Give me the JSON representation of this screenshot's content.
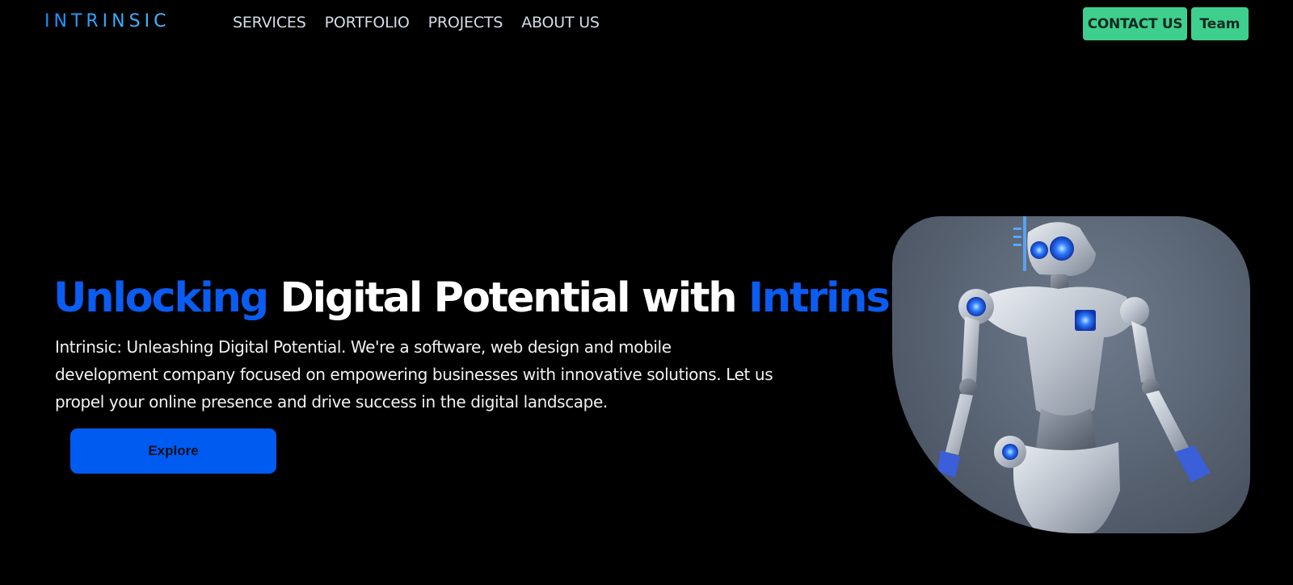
{
  "brand": {
    "logo_text": "INTRINSIC"
  },
  "nav": {
    "items": [
      {
        "label": "SERVICES"
      },
      {
        "label": "PORTFOLIO"
      },
      {
        "label": "PROJECTS"
      },
      {
        "label": "ABOUT US"
      }
    ]
  },
  "header_actions": {
    "contact_label": "CONTACT US",
    "team_label": "Team"
  },
  "hero": {
    "title_part1": "Unlocking",
    "title_part2": " Digital Potential with ",
    "title_part3": "Intrinsic",
    "description": "Intrinsic: Unleashing Digital Potential. We're a software, web design and mobile development company focused on empowering businesses with innovative solutions. Let us propel your online presence and drive success in the digital landscape.",
    "cta_label": "Explore",
    "image_subject": "robot-illustration"
  },
  "colors": {
    "background": "#000000",
    "accent_blue": "#0b5cf0",
    "button_blue": "#005bf0",
    "cta_green": "#3ecf8e",
    "logo_blue": "#1a8fff",
    "nav_text": "#d4dbe6"
  }
}
